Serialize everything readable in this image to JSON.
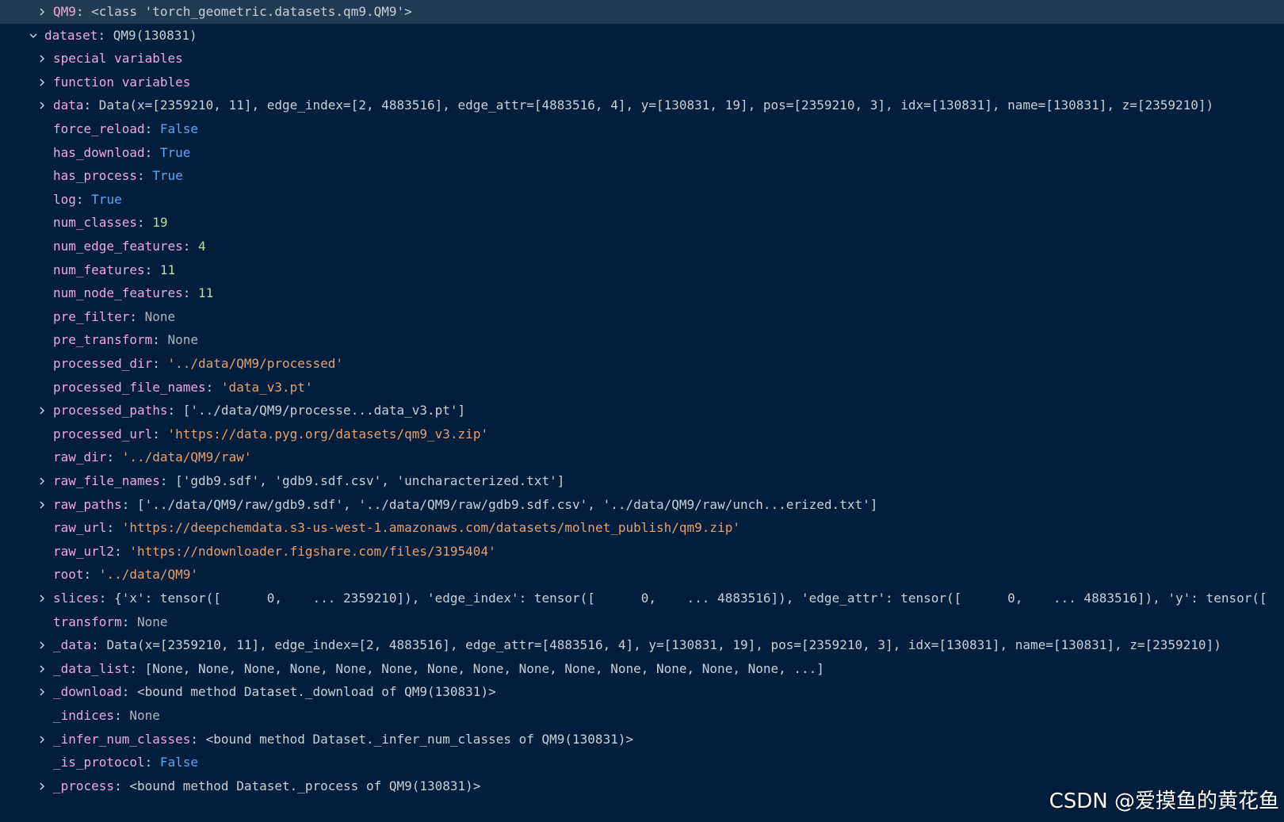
{
  "colors": {
    "background": "#011e3c",
    "selected_row": "#233a54",
    "key": "#f0a8e0",
    "value_default": "#c8d0da",
    "value_string": "#e9a06d",
    "value_bool": "#5aa6f5",
    "value_number": "#b9dfa0",
    "value_none": "#a9b5c2"
  },
  "variables": [
    {
      "level": 1,
      "twisty": "collapsed",
      "selected": true,
      "key": "QM9",
      "value": "<class 'torch_geometric.datasets.qm9.QM9'>",
      "type": "default"
    },
    {
      "level": 0,
      "twisty": "expanded",
      "key": "dataset",
      "value": "QM9(130831)",
      "type": "default"
    },
    {
      "level": 1,
      "twisty": "collapsed",
      "key": "special variables",
      "value": "",
      "type": "default"
    },
    {
      "level": 1,
      "twisty": "collapsed",
      "key": "function variables",
      "value": "",
      "type": "default"
    },
    {
      "level": 1,
      "twisty": "collapsed",
      "key": "data",
      "value": "Data(x=[2359210, 11], edge_index=[2, 4883516], edge_attr=[4883516, 4], y=[130831, 19], pos=[2359210, 3], idx=[130831], name=[130831], z=[2359210])",
      "type": "default"
    },
    {
      "level": 1,
      "twisty": "none",
      "key": "force_reload",
      "value": "False",
      "type": "bool"
    },
    {
      "level": 1,
      "twisty": "none",
      "key": "has_download",
      "value": "True",
      "type": "bool"
    },
    {
      "level": 1,
      "twisty": "none",
      "key": "has_process",
      "value": "True",
      "type": "bool"
    },
    {
      "level": 1,
      "twisty": "none",
      "key": "log",
      "value": "True",
      "type": "bool"
    },
    {
      "level": 1,
      "twisty": "none",
      "key": "num_classes",
      "value": "19",
      "type": "number"
    },
    {
      "level": 1,
      "twisty": "none",
      "key": "num_edge_features",
      "value": "4",
      "type": "number"
    },
    {
      "level": 1,
      "twisty": "none",
      "key": "num_features",
      "value": "11",
      "type": "number"
    },
    {
      "level": 1,
      "twisty": "none",
      "key": "num_node_features",
      "value": "11",
      "type": "number"
    },
    {
      "level": 1,
      "twisty": "none",
      "key": "pre_filter",
      "value": "None",
      "type": "none"
    },
    {
      "level": 1,
      "twisty": "none",
      "key": "pre_transform",
      "value": "None",
      "type": "none"
    },
    {
      "level": 1,
      "twisty": "none",
      "key": "processed_dir",
      "value": "'../data/QM9/processed'",
      "type": "string"
    },
    {
      "level": 1,
      "twisty": "none",
      "key": "processed_file_names",
      "value": "'data_v3.pt'",
      "type": "string"
    },
    {
      "level": 1,
      "twisty": "collapsed",
      "key": "processed_paths",
      "value": "['../data/QM9/processe...data_v3.pt']",
      "type": "default"
    },
    {
      "level": 1,
      "twisty": "none",
      "key": "processed_url",
      "value": "'https://data.pyg.org/datasets/qm9_v3.zip'",
      "type": "string"
    },
    {
      "level": 1,
      "twisty": "none",
      "key": "raw_dir",
      "value": "'../data/QM9/raw'",
      "type": "string"
    },
    {
      "level": 1,
      "twisty": "collapsed",
      "key": "raw_file_names",
      "value": "['gdb9.sdf', 'gdb9.sdf.csv', 'uncharacterized.txt']",
      "type": "default"
    },
    {
      "level": 1,
      "twisty": "collapsed",
      "key": "raw_paths",
      "value": "['../data/QM9/raw/gdb9.sdf', '../data/QM9/raw/gdb9.sdf.csv', '../data/QM9/raw/unch...erized.txt']",
      "type": "default"
    },
    {
      "level": 1,
      "twisty": "none",
      "key": "raw_url",
      "value": "'https://deepchemdata.s3-us-west-1.amazonaws.com/datasets/molnet_publish/qm9.zip'",
      "type": "string"
    },
    {
      "level": 1,
      "twisty": "none",
      "key": "raw_url2",
      "value": "'https://ndownloader.figshare.com/files/3195404'",
      "type": "string"
    },
    {
      "level": 1,
      "twisty": "none",
      "key": "root",
      "value": "'../data/QM9'",
      "type": "string"
    },
    {
      "level": 1,
      "twisty": "collapsed",
      "key": "slices",
      "value": "{'x': tensor([      0,    ... 2359210]), 'edge_index': tensor([      0,    ... 4883516]), 'edge_attr': tensor([      0,    ... 4883516]), 'y': tensor([",
      "type": "default"
    },
    {
      "level": 1,
      "twisty": "none",
      "key": "transform",
      "value": "None",
      "type": "none"
    },
    {
      "level": 1,
      "twisty": "collapsed",
      "key": "_data",
      "value": "Data(x=[2359210, 11], edge_index=[2, 4883516], edge_attr=[4883516, 4], y=[130831, 19], pos=[2359210, 3], idx=[130831], name=[130831], z=[2359210])",
      "type": "default"
    },
    {
      "level": 1,
      "twisty": "collapsed",
      "key": "_data_list",
      "value": "[None, None, None, None, None, None, None, None, None, None, None, None, None, None, ...]",
      "type": "default"
    },
    {
      "level": 1,
      "twisty": "collapsed",
      "key": "_download",
      "value": "<bound method Dataset._download of QM9(130831)>",
      "type": "default"
    },
    {
      "level": 1,
      "twisty": "none",
      "key": "_indices",
      "value": "None",
      "type": "none"
    },
    {
      "level": 1,
      "twisty": "collapsed",
      "key": "_infer_num_classes",
      "value": "<bound method Dataset._infer_num_classes of QM9(130831)>",
      "type": "default"
    },
    {
      "level": 1,
      "twisty": "none",
      "key": "_is_protocol",
      "value": "False",
      "type": "bool"
    },
    {
      "level": 1,
      "twisty": "collapsed",
      "key": "_process",
      "value": "<bound method Dataset._process of QM9(130831)>",
      "type": "default"
    }
  ],
  "watermark": "CSDN @爱摸鱼的黄花鱼"
}
